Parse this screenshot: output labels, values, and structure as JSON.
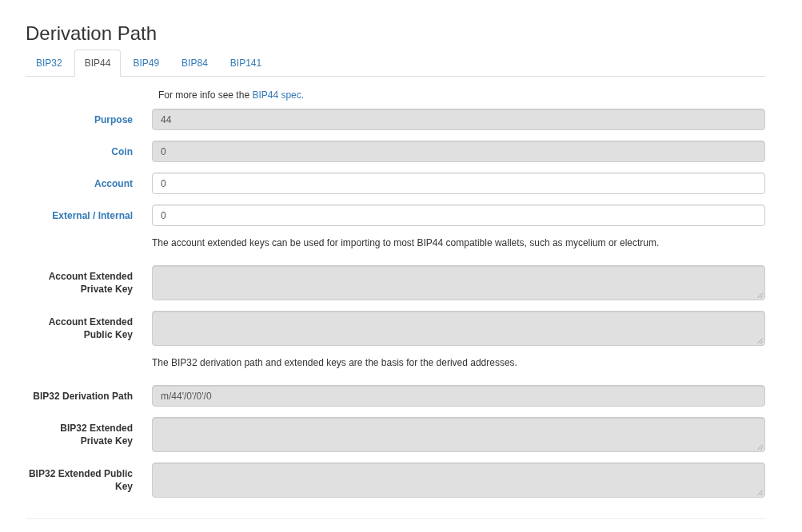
{
  "title": "Derivation Path",
  "tabs": [
    {
      "label": "BIP32",
      "selected": false
    },
    {
      "label": "BIP44",
      "selected": true
    },
    {
      "label": "BIP49",
      "selected": false
    },
    {
      "label": "BIP84",
      "selected": false
    },
    {
      "label": "BIP141",
      "selected": false
    }
  ],
  "form": [
    {
      "kind": "note",
      "text": "For more info see the ",
      "link": "BIP44 spec."
    },
    {
      "kind": "input",
      "label": "Purpose",
      "linked": true,
      "readonly": true,
      "value": "44"
    },
    {
      "kind": "input",
      "label": "Coin",
      "linked": true,
      "readonly": true,
      "value": "0"
    },
    {
      "kind": "input",
      "label": "Account",
      "linked": true,
      "readonly": false,
      "value": "0"
    },
    {
      "kind": "input",
      "label": "External / Internal",
      "linked": true,
      "readonly": false,
      "value": "0"
    },
    {
      "kind": "note",
      "text": "The account extended keys can be used for importing to most BIP44 compatible wallets, such as mycelium or electrum."
    },
    {
      "kind": "textarea",
      "label": "Account Extended Private Key",
      "linked": false,
      "readonly": true
    },
    {
      "kind": "textarea",
      "label": "Account Extended Public Key",
      "linked": false,
      "readonly": true
    },
    {
      "kind": "note",
      "text": "The BIP32 derivation path and extended keys are the basis for the derived addresses."
    },
    {
      "kind": "input",
      "label": "BIP32 Derivation Path",
      "linked": false,
      "readonly": true,
      "value": "m/44'/0'/0'/0"
    },
    {
      "kind": "textarea",
      "label": "BIP32 Extended Private Key",
      "linked": false,
      "readonly": true
    },
    {
      "kind": "textarea",
      "label": "BIP32 Extended Public Key",
      "linked": false,
      "readonly": true
    }
  ]
}
